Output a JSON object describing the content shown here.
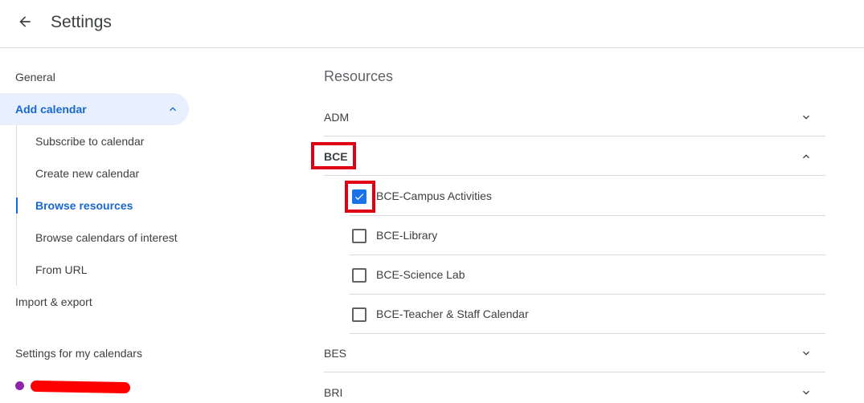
{
  "header": {
    "title": "Settings"
  },
  "sidebar": {
    "general": "General",
    "add_calendar": "Add calendar",
    "sub_items": [
      {
        "label": "Subscribe to calendar"
      },
      {
        "label": "Create new calendar"
      },
      {
        "label": "Browse resources"
      },
      {
        "label": "Browse calendars of interest"
      },
      {
        "label": "From URL"
      }
    ],
    "import_export": "Import & export",
    "my_calendars_heading": "Settings for my calendars",
    "calendar_dot_color": "#8e24aa"
  },
  "main": {
    "title": "Resources",
    "groups": [
      {
        "label": "ADM",
        "expanded": false
      },
      {
        "label": "BCE",
        "expanded": true
      },
      {
        "label": "BES",
        "expanded": false
      },
      {
        "label": "BRI",
        "expanded": false
      }
    ],
    "bce_resources": [
      {
        "label": "BCE-Campus Activities",
        "checked": true
      },
      {
        "label": "BCE-Library",
        "checked": false
      },
      {
        "label": "BCE-Science Lab",
        "checked": false
      },
      {
        "label": "BCE-Teacher & Staff Calendar",
        "checked": false
      }
    ]
  },
  "colors": {
    "accent": "#1967d2",
    "checkbox_checked": "#1a73e8",
    "highlight_box": "#e00014"
  }
}
